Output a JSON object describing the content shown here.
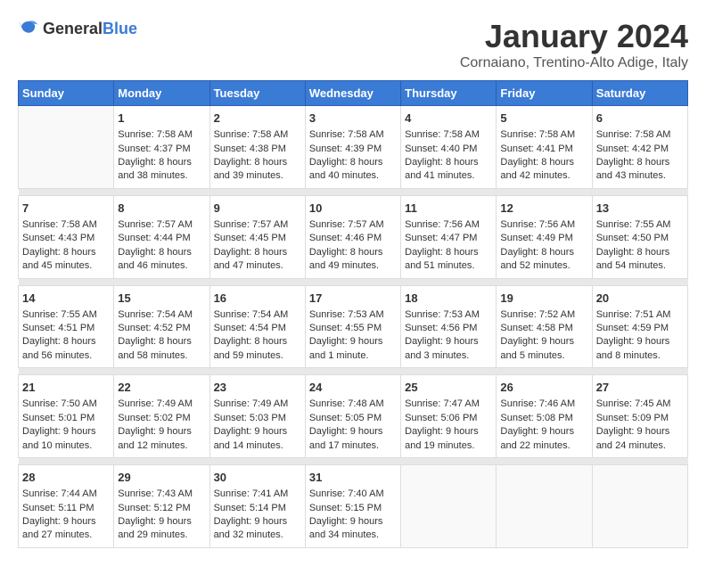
{
  "logo": {
    "general": "General",
    "blue": "Blue"
  },
  "header": {
    "month": "January 2024",
    "location": "Cornaiano, Trentino-Alto Adige, Italy"
  },
  "columns": [
    "Sunday",
    "Monday",
    "Tuesday",
    "Wednesday",
    "Thursday",
    "Friday",
    "Saturday"
  ],
  "weeks": [
    [
      {
        "day": "",
        "sunrise": "",
        "sunset": "",
        "daylight": ""
      },
      {
        "day": "1",
        "sunrise": "Sunrise: 7:58 AM",
        "sunset": "Sunset: 4:37 PM",
        "daylight": "Daylight: 8 hours and 38 minutes."
      },
      {
        "day": "2",
        "sunrise": "Sunrise: 7:58 AM",
        "sunset": "Sunset: 4:38 PM",
        "daylight": "Daylight: 8 hours and 39 minutes."
      },
      {
        "day": "3",
        "sunrise": "Sunrise: 7:58 AM",
        "sunset": "Sunset: 4:39 PM",
        "daylight": "Daylight: 8 hours and 40 minutes."
      },
      {
        "day": "4",
        "sunrise": "Sunrise: 7:58 AM",
        "sunset": "Sunset: 4:40 PM",
        "daylight": "Daylight: 8 hours and 41 minutes."
      },
      {
        "day": "5",
        "sunrise": "Sunrise: 7:58 AM",
        "sunset": "Sunset: 4:41 PM",
        "daylight": "Daylight: 8 hours and 42 minutes."
      },
      {
        "day": "6",
        "sunrise": "Sunrise: 7:58 AM",
        "sunset": "Sunset: 4:42 PM",
        "daylight": "Daylight: 8 hours and 43 minutes."
      }
    ],
    [
      {
        "day": "7",
        "sunrise": "Sunrise: 7:58 AM",
        "sunset": "Sunset: 4:43 PM",
        "daylight": "Daylight: 8 hours and 45 minutes."
      },
      {
        "day": "8",
        "sunrise": "Sunrise: 7:57 AM",
        "sunset": "Sunset: 4:44 PM",
        "daylight": "Daylight: 8 hours and 46 minutes."
      },
      {
        "day": "9",
        "sunrise": "Sunrise: 7:57 AM",
        "sunset": "Sunset: 4:45 PM",
        "daylight": "Daylight: 8 hours and 47 minutes."
      },
      {
        "day": "10",
        "sunrise": "Sunrise: 7:57 AM",
        "sunset": "Sunset: 4:46 PM",
        "daylight": "Daylight: 8 hours and 49 minutes."
      },
      {
        "day": "11",
        "sunrise": "Sunrise: 7:56 AM",
        "sunset": "Sunset: 4:47 PM",
        "daylight": "Daylight: 8 hours and 51 minutes."
      },
      {
        "day": "12",
        "sunrise": "Sunrise: 7:56 AM",
        "sunset": "Sunset: 4:49 PM",
        "daylight": "Daylight: 8 hours and 52 minutes."
      },
      {
        "day": "13",
        "sunrise": "Sunrise: 7:55 AM",
        "sunset": "Sunset: 4:50 PM",
        "daylight": "Daylight: 8 hours and 54 minutes."
      }
    ],
    [
      {
        "day": "14",
        "sunrise": "Sunrise: 7:55 AM",
        "sunset": "Sunset: 4:51 PM",
        "daylight": "Daylight: 8 hours and 56 minutes."
      },
      {
        "day": "15",
        "sunrise": "Sunrise: 7:54 AM",
        "sunset": "Sunset: 4:52 PM",
        "daylight": "Daylight: 8 hours and 58 minutes."
      },
      {
        "day": "16",
        "sunrise": "Sunrise: 7:54 AM",
        "sunset": "Sunset: 4:54 PM",
        "daylight": "Daylight: 8 hours and 59 minutes."
      },
      {
        "day": "17",
        "sunrise": "Sunrise: 7:53 AM",
        "sunset": "Sunset: 4:55 PM",
        "daylight": "Daylight: 9 hours and 1 minute."
      },
      {
        "day": "18",
        "sunrise": "Sunrise: 7:53 AM",
        "sunset": "Sunset: 4:56 PM",
        "daylight": "Daylight: 9 hours and 3 minutes."
      },
      {
        "day": "19",
        "sunrise": "Sunrise: 7:52 AM",
        "sunset": "Sunset: 4:58 PM",
        "daylight": "Daylight: 9 hours and 5 minutes."
      },
      {
        "day": "20",
        "sunrise": "Sunrise: 7:51 AM",
        "sunset": "Sunset: 4:59 PM",
        "daylight": "Daylight: 9 hours and 8 minutes."
      }
    ],
    [
      {
        "day": "21",
        "sunrise": "Sunrise: 7:50 AM",
        "sunset": "Sunset: 5:01 PM",
        "daylight": "Daylight: 9 hours and 10 minutes."
      },
      {
        "day": "22",
        "sunrise": "Sunrise: 7:49 AM",
        "sunset": "Sunset: 5:02 PM",
        "daylight": "Daylight: 9 hours and 12 minutes."
      },
      {
        "day": "23",
        "sunrise": "Sunrise: 7:49 AM",
        "sunset": "Sunset: 5:03 PM",
        "daylight": "Daylight: 9 hours and 14 minutes."
      },
      {
        "day": "24",
        "sunrise": "Sunrise: 7:48 AM",
        "sunset": "Sunset: 5:05 PM",
        "daylight": "Daylight: 9 hours and 17 minutes."
      },
      {
        "day": "25",
        "sunrise": "Sunrise: 7:47 AM",
        "sunset": "Sunset: 5:06 PM",
        "daylight": "Daylight: 9 hours and 19 minutes."
      },
      {
        "day": "26",
        "sunrise": "Sunrise: 7:46 AM",
        "sunset": "Sunset: 5:08 PM",
        "daylight": "Daylight: 9 hours and 22 minutes."
      },
      {
        "day": "27",
        "sunrise": "Sunrise: 7:45 AM",
        "sunset": "Sunset: 5:09 PM",
        "daylight": "Daylight: 9 hours and 24 minutes."
      }
    ],
    [
      {
        "day": "28",
        "sunrise": "Sunrise: 7:44 AM",
        "sunset": "Sunset: 5:11 PM",
        "daylight": "Daylight: 9 hours and 27 minutes."
      },
      {
        "day": "29",
        "sunrise": "Sunrise: 7:43 AM",
        "sunset": "Sunset: 5:12 PM",
        "daylight": "Daylight: 9 hours and 29 minutes."
      },
      {
        "day": "30",
        "sunrise": "Sunrise: 7:41 AM",
        "sunset": "Sunset: 5:14 PM",
        "daylight": "Daylight: 9 hours and 32 minutes."
      },
      {
        "day": "31",
        "sunrise": "Sunrise: 7:40 AM",
        "sunset": "Sunset: 5:15 PM",
        "daylight": "Daylight: 9 hours and 34 minutes."
      },
      {
        "day": "",
        "sunrise": "",
        "sunset": "",
        "daylight": ""
      },
      {
        "day": "",
        "sunrise": "",
        "sunset": "",
        "daylight": ""
      },
      {
        "day": "",
        "sunrise": "",
        "sunset": "",
        "daylight": ""
      }
    ]
  ]
}
